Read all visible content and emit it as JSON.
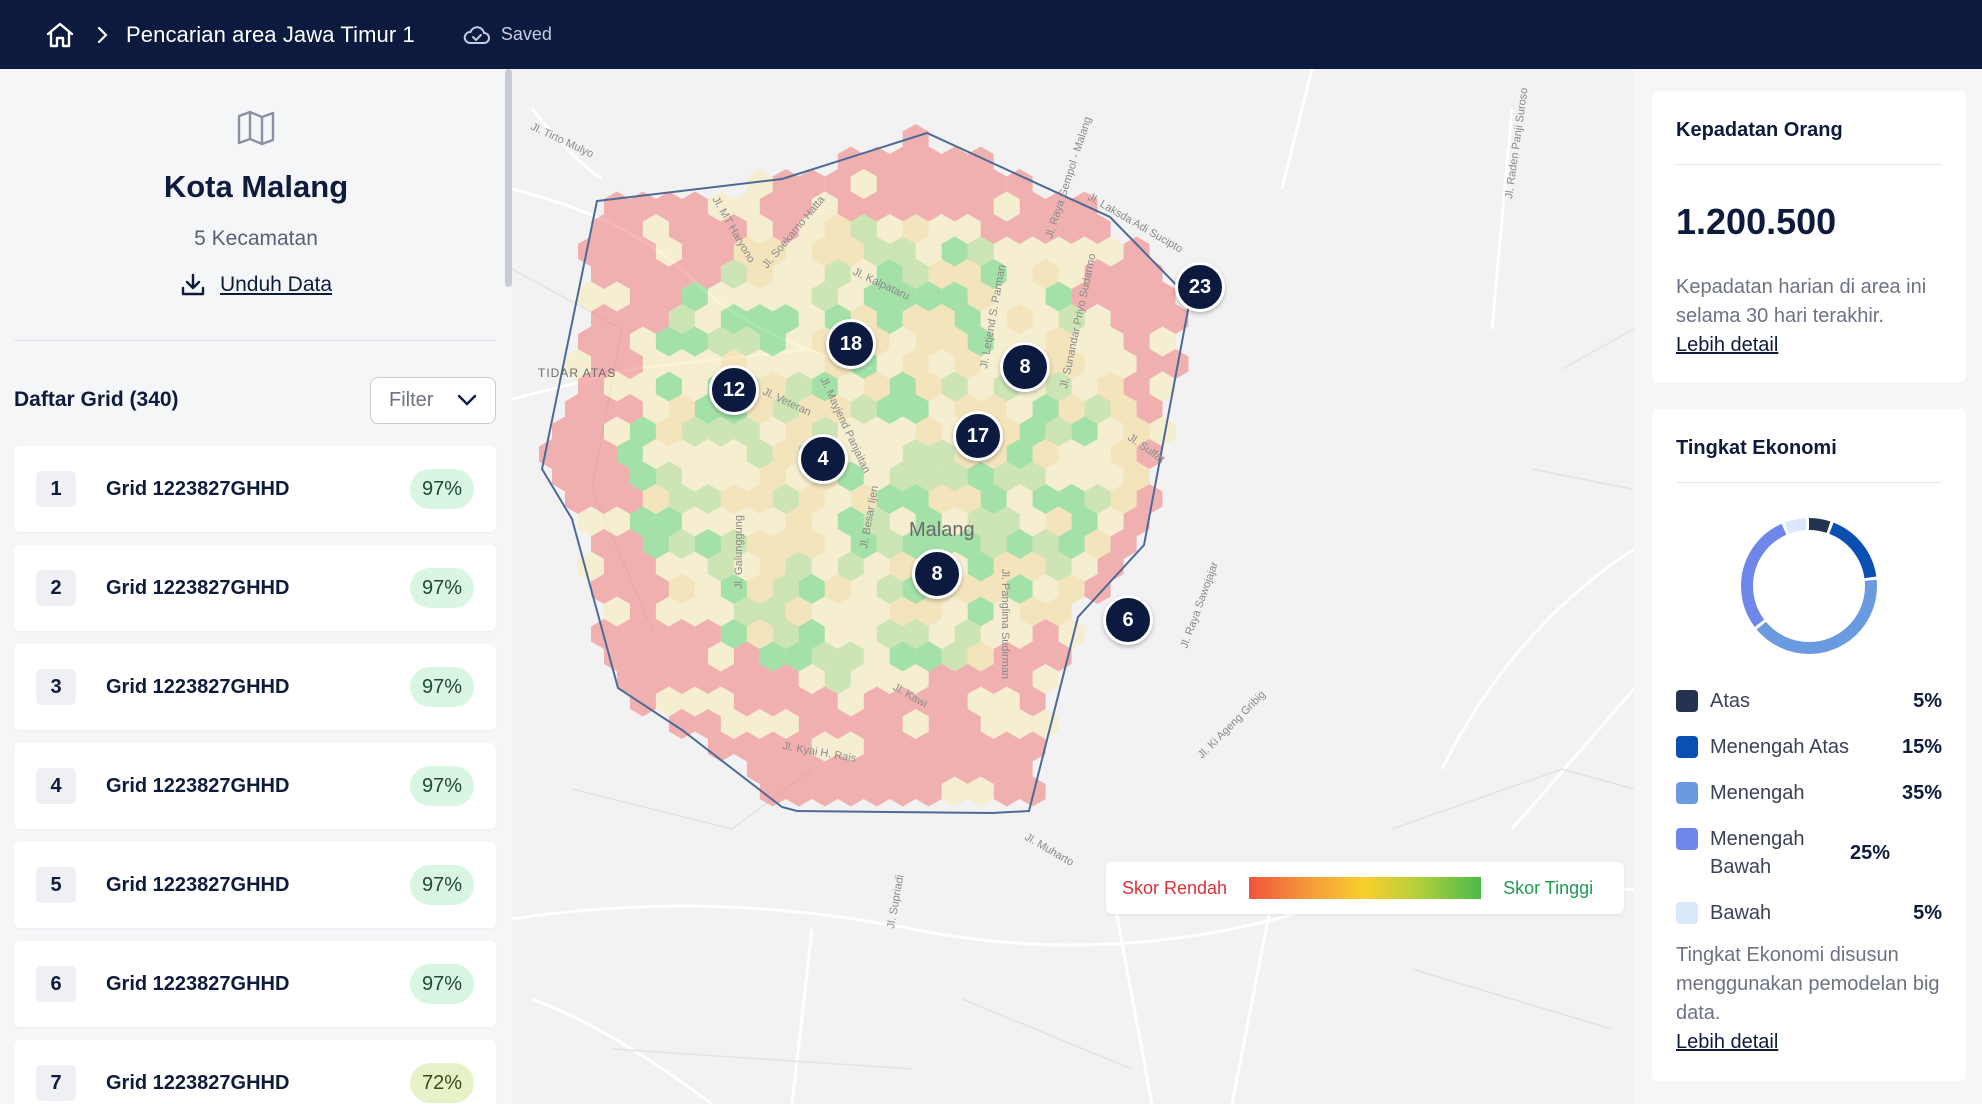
{
  "header": {
    "breadcrumb": "Pencarian area Jawa Timur 1",
    "status": "Saved"
  },
  "left": {
    "city": "Kota Malang",
    "subtitle": "5 Kecamatan",
    "download_label": "Unduh Data",
    "grid_title": "Daftar Grid (340)",
    "filter_label": "Filter",
    "rows": [
      {
        "num": "1",
        "name": "Grid 1223827GHHD",
        "pct": "97%"
      },
      {
        "num": "2",
        "name": "Grid 1223827GHHD",
        "pct": "97%"
      },
      {
        "num": "3",
        "name": "Grid 1223827GHHD",
        "pct": "97%"
      },
      {
        "num": "4",
        "name": "Grid 1223827GHHD",
        "pct": "97%"
      },
      {
        "num": "5",
        "name": "Grid 1223827GHHD",
        "pct": "97%"
      },
      {
        "num": "6",
        "name": "Grid 1223827GHHD",
        "pct": "97%"
      },
      {
        "num": "7",
        "name": "Grid 1223827GHHD",
        "pct": "72%"
      }
    ]
  },
  "map": {
    "city_label": "Malang",
    "area_label": "TIDAR ATAS",
    "streets": [
      "Jl. Tirto Mulyo",
      "Jl. MT Haryono",
      "Jl. Soekarno Hatta",
      "Jl. Kalpataru",
      "Jl. Letjend S. Parman",
      "Jl. Sunandar Priyo Sudarmo",
      "Jl. Laksda Adi Sucipto",
      "Jl. Raya Gempol - Malang",
      "Jl. Mayjend Panjaitan",
      "Jl. Veteran",
      "Jl. Galunggung",
      "Jl. Besar Ijen",
      "Jl. Panglima Sudirman",
      "Jl. Sulfat",
      "Jl. Kawi",
      "Jl. Ki Ageng Gribig",
      "Jl. Raya Sawojajar",
      "Jl. Supriadi",
      "Jl. Muharto",
      "Jl. Raden Panji Suroso",
      "Jl. Kyai H. Rais"
    ],
    "markers": [
      "23",
      "18",
      "8",
      "12",
      "17",
      "4",
      "8",
      "6"
    ],
    "legend_low": "Skor Rendah",
    "legend_high": "Skor Tinggi"
  },
  "right": {
    "density": {
      "title": "Kepadatan Orang",
      "value": "1.200.500",
      "description": "Kepadatan harian di area ini selama 30 hari terakhir.",
      "link": "Lebih detail"
    },
    "economy": {
      "title": "Tingkat Ekonomi",
      "items": [
        {
          "label": "Atas",
          "value": "5%",
          "pct": 5,
          "color": "#243352"
        },
        {
          "label": "Menengah Atas",
          "value": "15%",
          "pct": 15,
          "color": "#0b4fb3"
        },
        {
          "label": "Menengah",
          "value": "35%",
          "pct": 35,
          "color": "#6a9be0"
        },
        {
          "label": "Menengah Bawah",
          "value": "25%",
          "pct": 25,
          "color": "#6f86ea"
        },
        {
          "label": "Bawah",
          "value": "5%",
          "pct": 5,
          "color": "#dbe8fb"
        }
      ],
      "description": "Tingkat Ekonomi disusun menggunakan pemodelan big data.",
      "link": "Lebih detail"
    }
  },
  "colors": {
    "navy": "#0b1a3e",
    "score_low": "#f1543b",
    "score_high": "#4cba4c"
  }
}
